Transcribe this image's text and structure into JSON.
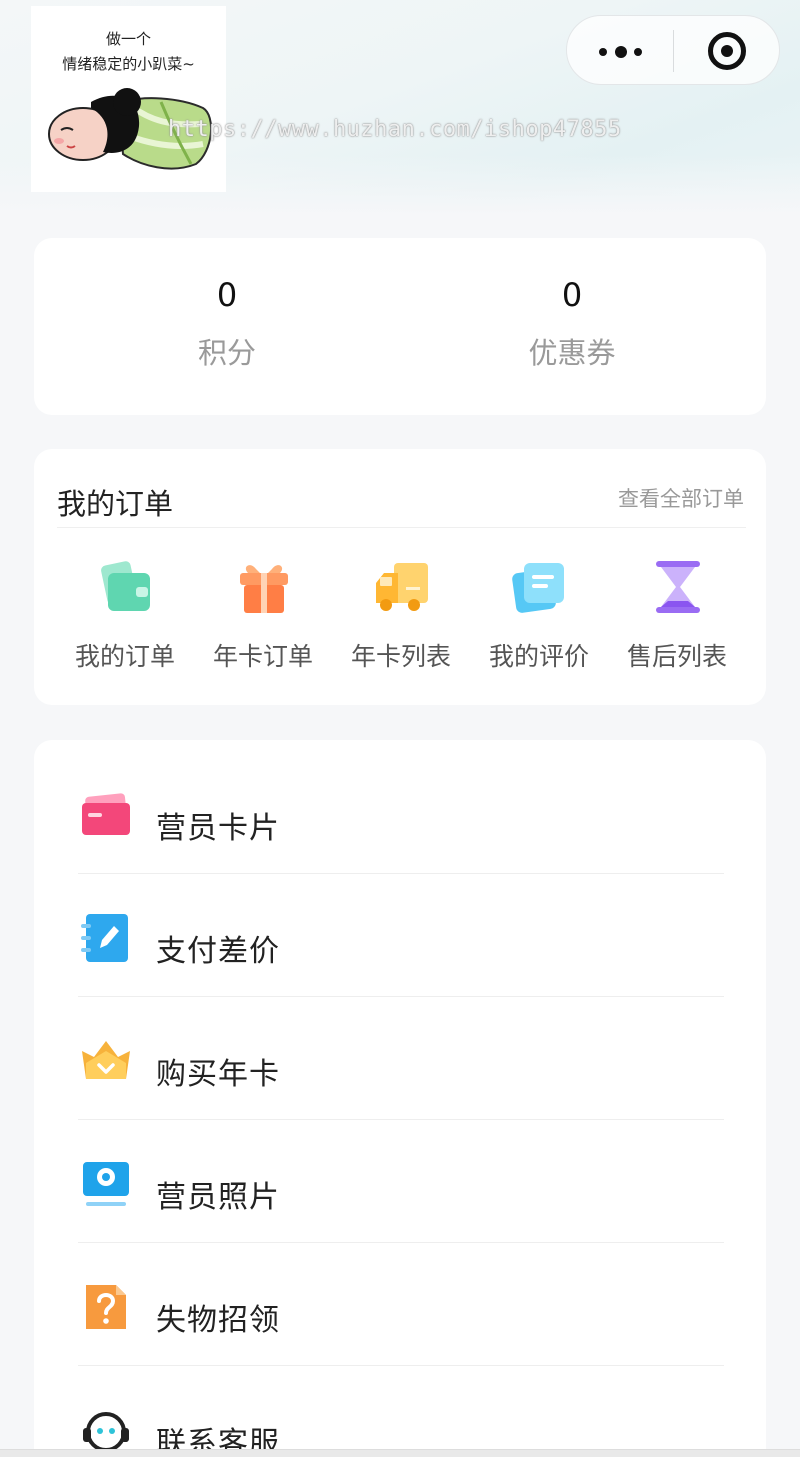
{
  "header": {
    "avatar_caption_line1": "做一个",
    "avatar_caption_line2": "情绪稳定的小趴菜~",
    "watermark": "https://www.huzhan.com/ishop47855"
  },
  "stats": [
    {
      "value": "0",
      "label": "积分"
    },
    {
      "value": "0",
      "label": "优惠券"
    }
  ],
  "orders": {
    "title": "我的订单",
    "view_all": "查看全部订单",
    "items": [
      {
        "label": "我的订单",
        "icon": "wallet-icon"
      },
      {
        "label": "年卡订单",
        "icon": "gift-icon"
      },
      {
        "label": "年卡列表",
        "icon": "truck-icon"
      },
      {
        "label": "我的评价",
        "icon": "document-icon"
      },
      {
        "label": "售后列表",
        "icon": "hourglass-icon"
      }
    ]
  },
  "menu": [
    {
      "label": "营员卡片",
      "icon": "card-icon"
    },
    {
      "label": "支付差价",
      "icon": "notebook-pen-icon"
    },
    {
      "label": "购买年卡",
      "icon": "crown-icon"
    },
    {
      "label": "营员照片",
      "icon": "monitor-photo-icon"
    },
    {
      "label": "失物招领",
      "icon": "question-doc-icon"
    },
    {
      "label": "联系客服",
      "icon": "headset-icon"
    }
  ],
  "colors": {
    "menu_card_icon": "#f3477a",
    "menu_pen_icon": "#2ea8ee",
    "menu_crown_icon": "#f7b23b",
    "menu_photo_icon": "#1fa3ea",
    "menu_question_icon": "#f79a3e"
  }
}
